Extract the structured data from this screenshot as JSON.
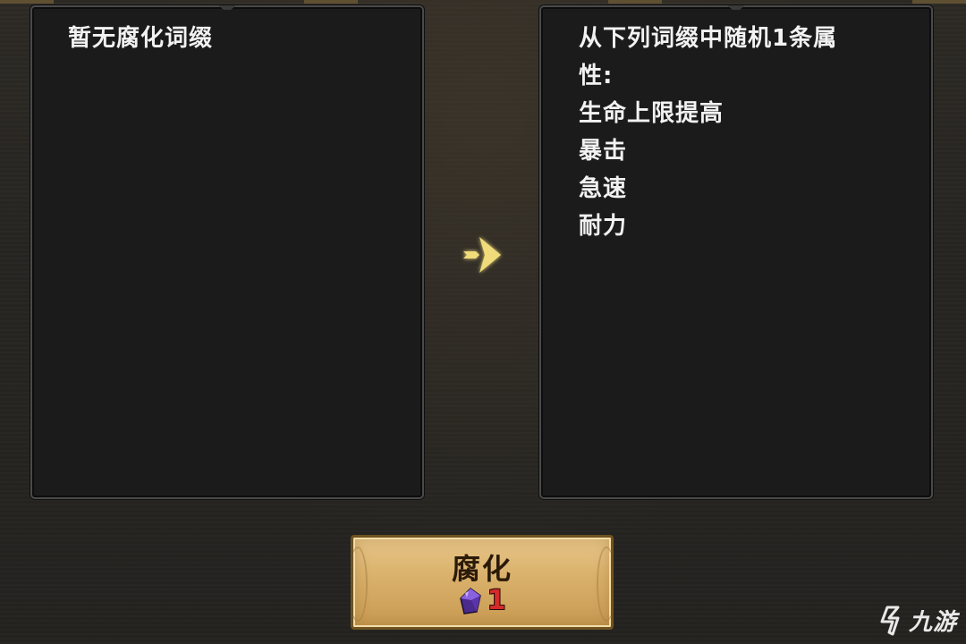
{
  "current_panel": {
    "text": "暂无腐化词缀"
  },
  "result_panel": {
    "intro_lines": [
      "从下列词缀中随机1条属",
      "性:"
    ],
    "affixes": [
      "生命上限提高",
      "暴击",
      "急速",
      "耐力"
    ]
  },
  "corrupt_button": {
    "label": "腐化",
    "cost": "1",
    "cost_icon": "purple-crystal-icon"
  },
  "watermark": {
    "text": "九游"
  },
  "colors": {
    "panel_bg": "#1b1b1c",
    "text": "#f2f2f2",
    "arrow": "#f0dc7a",
    "button_gold": "#d9b06a",
    "cost_red": "#d42a2a",
    "gem_purple": "#6a3fc4"
  }
}
